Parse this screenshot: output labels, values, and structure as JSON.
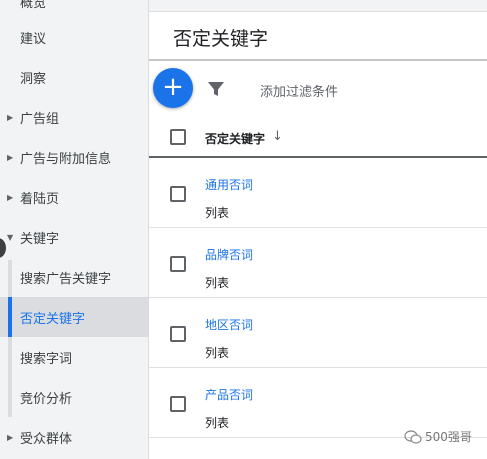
{
  "sidebar": {
    "items": [
      {
        "label": "概览"
      },
      {
        "label": "建议"
      },
      {
        "label": "洞察"
      },
      {
        "label": "广告组"
      },
      {
        "label": "广告与附加信息"
      },
      {
        "label": "着陆页"
      },
      {
        "label": "关键字"
      },
      {
        "label": "搜索广告关键字"
      },
      {
        "label": "否定关键字"
      },
      {
        "label": "搜索字词"
      },
      {
        "label": "竞价分析"
      },
      {
        "label": "受众群体"
      }
    ]
  },
  "header": {
    "title": "否定关键字"
  },
  "toolbar": {
    "add_label": "+",
    "filter_placeholder": "添加过滤条件"
  },
  "table": {
    "column_header": "否定关键字",
    "sort_icon": "↓",
    "rows": [
      {
        "name": "通用否词",
        "type": "列表"
      },
      {
        "name": "品牌否词",
        "type": "列表"
      },
      {
        "name": "地区否词",
        "type": "列表"
      },
      {
        "name": "产品否词",
        "type": "列表"
      }
    ]
  },
  "watermark": {
    "text": "500强哥"
  },
  "colors": {
    "accent": "#1a73e8",
    "sidebar_bg": "#f1f3f4",
    "active_bg": "#dadce0"
  }
}
